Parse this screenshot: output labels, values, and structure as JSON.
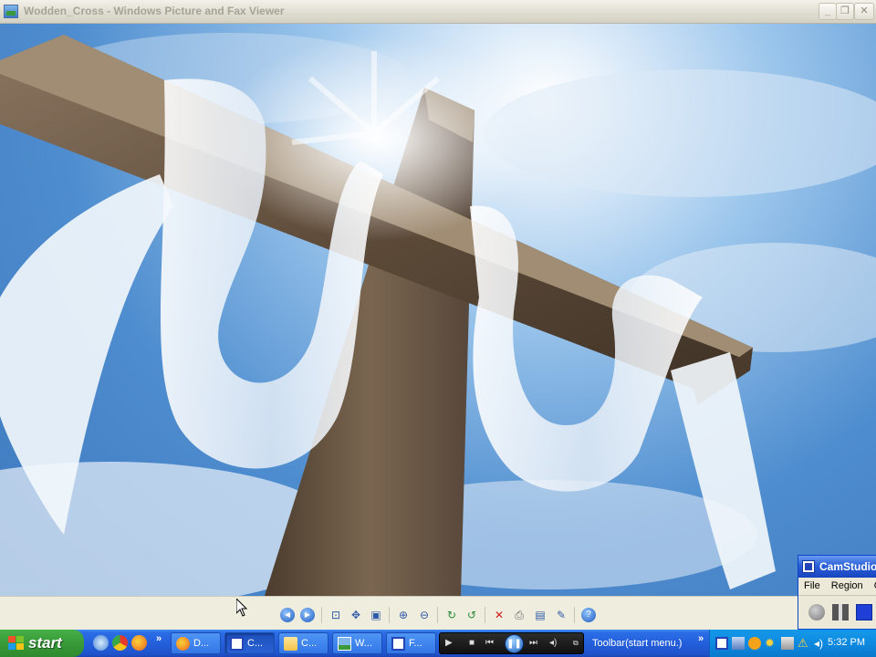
{
  "window": {
    "title": "Wodden_Cross - Windows Picture and Fax Viewer",
    "minimize_icon": "minimize-icon",
    "maximize_icon": "maximize-icon",
    "close_icon": "close-icon"
  },
  "image": {
    "description_icon": "wooden-cross-with-white-cloth-image"
  },
  "toolbar": {
    "buttons": [
      "previous-image-icon",
      "next-image-icon",
      "best-fit-icon",
      "actual-size-icon",
      "slideshow-icon",
      "zoom-in-icon",
      "zoom-out-icon",
      "rotate-clockwise-icon",
      "rotate-counterclockwise-icon",
      "delete-icon",
      "print-icon",
      "save-icon",
      "edit-icon",
      "help-icon"
    ]
  },
  "camstudio": {
    "title": "CamStudio",
    "menu": [
      "File",
      "Region",
      "Op"
    ]
  },
  "taskbar": {
    "start_label": "start",
    "tasks": [
      {
        "label": "D...",
        "icon": "firefox-icon"
      },
      {
        "label": "C...",
        "icon": "camstudio-icon"
      },
      {
        "label": "C...",
        "icon": "folder-icon"
      },
      {
        "label": "W...",
        "icon": "picture-viewer-icon"
      },
      {
        "label": "F...",
        "icon": "camstudio-icon"
      }
    ],
    "toolbar_label": "Toolbar(start menu.)",
    "clock": "5:32 PM"
  },
  "colors": {
    "taskbar_blue": "#245fdb",
    "start_green": "#3a9c3a",
    "tray_blue": "#0d8adf",
    "toolbar_bg": "#efedde"
  }
}
